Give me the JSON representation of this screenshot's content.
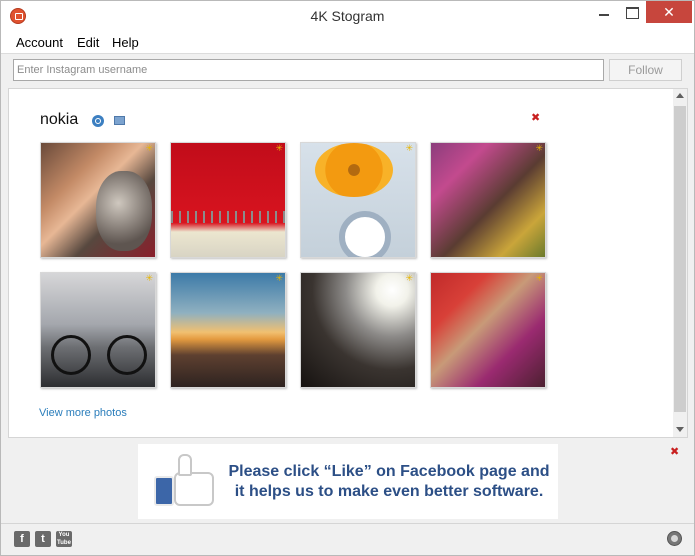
{
  "window": {
    "title": "4K Stogram",
    "controls": {
      "minimize": "",
      "maximize": "",
      "close": "✕"
    }
  },
  "menu": {
    "items": [
      {
        "label": "Account"
      },
      {
        "label": "Edit"
      },
      {
        "label": "Help"
      }
    ]
  },
  "search": {
    "placeholder": "Enter Instagram username",
    "value": "",
    "follow_label": "Follow"
  },
  "profile": {
    "username": "nokia",
    "remove_glyph": "✖",
    "photos": [
      {
        "subject": "woman-with-dog",
        "favorite_glyph": "✳"
      },
      {
        "subject": "red-wall-display",
        "favorite_glyph": "✳"
      },
      {
        "subject": "orange-flowers",
        "favorite_glyph": "✳"
      },
      {
        "subject": "two-children",
        "favorite_glyph": "✳"
      },
      {
        "subject": "man-with-bicycle",
        "favorite_glyph": "✳"
      },
      {
        "subject": "beach-sunset",
        "favorite_glyph": "✳"
      },
      {
        "subject": "concert-crowd",
        "favorite_glyph": "✳"
      },
      {
        "subject": "wedding-couple",
        "favorite_glyph": "✳"
      }
    ],
    "view_more_label": "View more photos"
  },
  "banner": {
    "text": "Please click “Like” on Facebook page and it helps us to make even better software.",
    "close_glyph": "✖"
  },
  "footer": {
    "facebook_glyph": "f",
    "twitter_glyph": "t",
    "youtube_glyph": "You Tube"
  },
  "colors": {
    "close_button": "#c7463d",
    "link": "#2a7dbb",
    "banner_text": "#2c4f86",
    "remove": "#c82020"
  }
}
